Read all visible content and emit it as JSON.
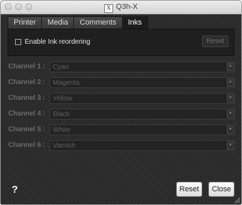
{
  "window": {
    "title": "Q3h-X"
  },
  "tabs": [
    {
      "label": "Printer",
      "active": false
    },
    {
      "label": "Media",
      "active": false
    },
    {
      "label": "Comments",
      "active": false
    },
    {
      "label": "Inks",
      "active": true
    }
  ],
  "inks_panel": {
    "enable_reorder_label": "Enable Ink reordering",
    "enable_reorder_checked": false,
    "panel_reset_label": "Reset"
  },
  "channels": [
    {
      "label": "Channel 1",
      "separator": ":",
      "value": "Cyan"
    },
    {
      "label": "Channel 2",
      "separator": ":",
      "value": "Magenta"
    },
    {
      "label": "Channel 3",
      "separator": ":",
      "value": "Yellow"
    },
    {
      "label": "Channel 4",
      "separator": ":",
      "value": "Black"
    },
    {
      "label": "Channel 5",
      "separator": ":",
      "value": "White"
    },
    {
      "label": "Channel 6",
      "separator": ":",
      "value": "Varnish"
    }
  ],
  "footer": {
    "help_label": "?",
    "reset_label": "Reset",
    "close_label": "Close"
  },
  "colors": {
    "background": "#2b2b2b",
    "panel": "#1f1f1f",
    "disabled_text": "#6a6a6a"
  },
  "icons": {
    "app": "x-window-icon",
    "dropdown": "chevron-down-icon"
  }
}
